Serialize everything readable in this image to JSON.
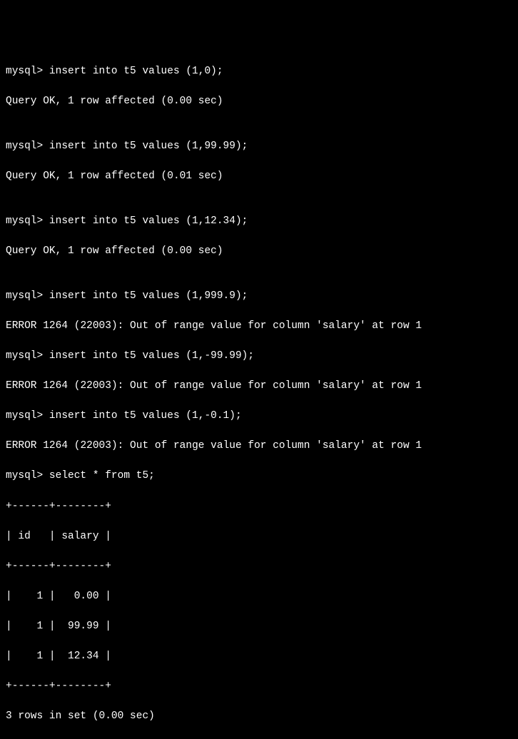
{
  "prompt": "mysql> ",
  "ok_tpl_a": "Query OK, ",
  "ok_tpl_b": " (",
  "ok_tpl_c": " sec)",
  "err_tpl_a": "ERROR ",
  "err_tpl_b": " (",
  "err_tpl_c": "): Out of range value for column '",
  "err_tpl_d": "' at row ",
  "inserts": [
    {
      "cmd": "insert into t5 values (1,0);",
      "rows": "1 row affected",
      "time": "0.00"
    },
    {
      "cmd": "insert into t5 values (1,99.99);",
      "rows": "1 row affected",
      "time": "0.01"
    },
    {
      "cmd": "insert into t5 values (1,12.34);",
      "rows": "1 row affected",
      "time": "0.00"
    }
  ],
  "errors": [
    {
      "cmd": "insert into t5 values (1,999.9);",
      "code": "1264",
      "sqlstate": "22003",
      "col": "salary",
      "row": "1"
    },
    {
      "cmd": "insert into t5 values (1,-99.99);",
      "code": "1264",
      "sqlstate": "22003",
      "col": "salary",
      "row": "1"
    },
    {
      "cmd": "insert into t5 values (1,-0.1);",
      "code": "1264",
      "sqlstate": "22003",
      "col": "salary",
      "row": "1"
    }
  ],
  "select_cmd": "select * from t5;",
  "table": {
    "border": "+------+--------+",
    "header": "| id   | salary |",
    "rows": [
      "|    1 |   0.00 |",
      "|    1 |  99.99 |",
      "|    1 |  12.34 |"
    ]
  },
  "footer_a": "3 rows in set",
  "footer_b": " (0.00 sec)",
  "blank": ""
}
